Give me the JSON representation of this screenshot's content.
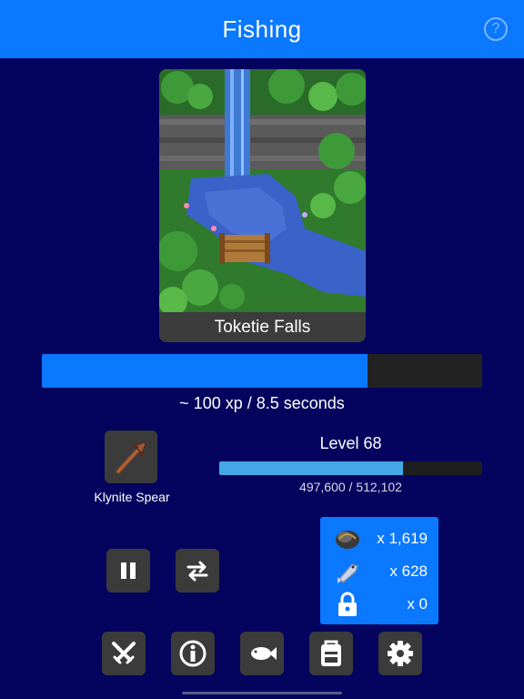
{
  "header": {
    "title": "Fishing",
    "help_glyph": "?"
  },
  "location": {
    "name": "Toketie Falls"
  },
  "action": {
    "progress": 0.74,
    "xp_rate": "~ 100 xp / 8.5 seconds"
  },
  "tool": {
    "name": "Klynite Spear",
    "icon": "spear-icon"
  },
  "skill": {
    "level_label": "Level 68",
    "xp_text": "497,600 / 512,102",
    "progress": 0.7
  },
  "controls": {
    "pause_icon": "pause-icon",
    "swap_icon": "swap-arrows-icon"
  },
  "inventory": {
    "items": [
      {
        "icon": "ore-icon",
        "qty": "x 1,619"
      },
      {
        "icon": "fish-icon",
        "qty": "x 628"
      },
      {
        "icon": "lock-icon",
        "qty": "x 0"
      }
    ]
  },
  "nav": [
    {
      "name": "combat",
      "icon": "crossed-swords-icon"
    },
    {
      "name": "info",
      "icon": "info-icon"
    },
    {
      "name": "fishing",
      "icon": "fish-icon"
    },
    {
      "name": "storage",
      "icon": "backpack-icon"
    },
    {
      "name": "settings",
      "icon": "gear-icon"
    }
  ],
  "colors": {
    "background": "#04045f",
    "accent": "#0a78ff",
    "tile": "#3b3b3b",
    "level_fill": "#45a8e6"
  }
}
